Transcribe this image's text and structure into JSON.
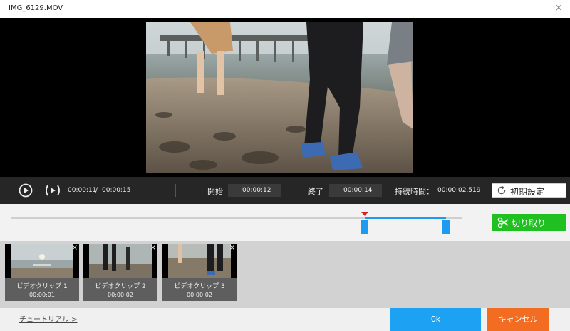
{
  "window": {
    "title": "IMG_6129.MOV",
    "close_icon": "×"
  },
  "player": {
    "current_time": "00:00:11",
    "separator": "/",
    "total_time": "00:00:15"
  },
  "trim": {
    "start_label": "開始",
    "start_value": "00:00:12",
    "end_label": "終了",
    "end_value": "00:00:14",
    "duration_label": "持続時間：",
    "duration_value": "00:00:02.519",
    "reset_label": "初期設定",
    "cut_label": "切り取り",
    "playhead_fraction": 0.78,
    "selection_start_fraction": 0.785,
    "selection_end_fraction": 0.965
  },
  "clips": [
    {
      "name": "ビデオクリップ 1",
      "duration": "00:00:01"
    },
    {
      "name": "ビデオクリップ 2",
      "duration": "00:00:02"
    },
    {
      "name": "ビデオクリップ 3",
      "duration": "00:00:02"
    }
  ],
  "footer": {
    "tutorial_link": "チュートリアル >",
    "ok_label": "0k",
    "cancel_label": "キャンセル"
  },
  "colors": {
    "accent_blue": "#1e9bf0",
    "cut_green": "#21c021",
    "cancel_orange": "#f26c22",
    "playhead_red": "#e02020"
  }
}
